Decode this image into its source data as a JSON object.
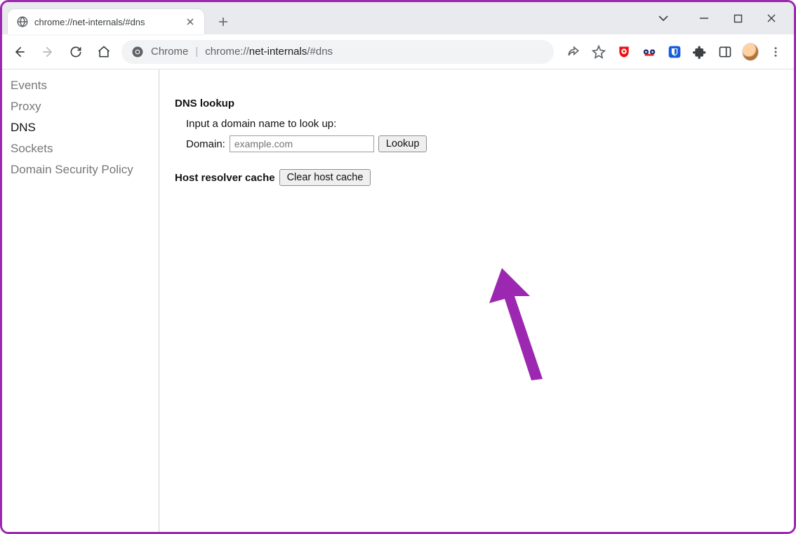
{
  "tab": {
    "title": "chrome://net-internals/#dns"
  },
  "omnibox": {
    "origin_label": "Chrome",
    "url_prefix": "chrome://",
    "url_bold": "net-internals",
    "url_suffix": "/#dns"
  },
  "sidebar": {
    "items": [
      {
        "label": "Events",
        "active": false
      },
      {
        "label": "Proxy",
        "active": false
      },
      {
        "label": "DNS",
        "active": true
      },
      {
        "label": "Sockets",
        "active": false
      },
      {
        "label": "Domain Security Policy",
        "active": false
      }
    ]
  },
  "dns": {
    "section_lookup": "DNS lookup",
    "prompt": "Input a domain name to look up:",
    "domain_label": "Domain:",
    "domain_placeholder": "example.com",
    "lookup_button": "Lookup",
    "section_cache": "Host resolver cache",
    "clear_button": "Clear host cache"
  }
}
